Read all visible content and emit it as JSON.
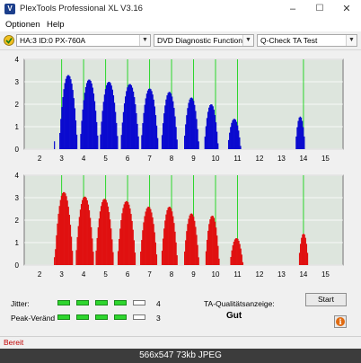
{
  "window": {
    "title": "PlexTools Professional XL V3.16",
    "app_icon_letter": "V",
    "minimize": "–",
    "maximize": "☐",
    "close": "✕"
  },
  "menu": [
    "Optionen",
    "Help"
  ],
  "toolbar": {
    "drive": "HA:3 ID:0  PX-760A",
    "function": "DVD Diagnostic Functions",
    "test": "Q-Check TA Test",
    "arrow": "▼"
  },
  "chart_data": [
    {
      "type": "bar",
      "name_key": "top",
      "color": "#0a0acf",
      "ylim": [
        0,
        4
      ],
      "yticks": [
        "0",
        "1",
        "2",
        "3",
        "4"
      ],
      "xlim": [
        1.3,
        15.8
      ],
      "xticks": [
        "2",
        "3",
        "4",
        "5",
        "6",
        "7",
        "8",
        "9",
        "10",
        "11",
        "12",
        "13",
        "14",
        "15"
      ],
      "green_lines": [
        3,
        4,
        5,
        6,
        7,
        8,
        9,
        10,
        11,
        14
      ],
      "peaks": [
        {
          "center": 3.3,
          "height": 3.3,
          "width": 0.85
        },
        {
          "center": 4.25,
          "height": 3.1,
          "width": 0.85
        },
        {
          "center": 5.15,
          "height": 3.0,
          "width": 0.85
        },
        {
          "center": 6.1,
          "height": 2.9,
          "width": 0.85
        },
        {
          "center": 7.0,
          "height": 2.7,
          "width": 0.8
        },
        {
          "center": 7.9,
          "height": 2.55,
          "width": 0.75
        },
        {
          "center": 8.9,
          "height": 2.3,
          "width": 0.7
        },
        {
          "center": 9.8,
          "height": 2.0,
          "width": 0.65
        },
        {
          "center": 10.85,
          "height": 1.35,
          "width": 0.6
        },
        {
          "center": 13.85,
          "height": 1.45,
          "width": 0.45
        }
      ]
    },
    {
      "type": "bar",
      "name_key": "bottom",
      "color": "#e01010",
      "ylim": [
        0,
        4
      ],
      "yticks": [
        "0",
        "1",
        "2",
        "3",
        "4"
      ],
      "xlim": [
        1.3,
        15.8
      ],
      "xticks": [
        "2",
        "3",
        "4",
        "5",
        "6",
        "7",
        "8",
        "9",
        "10",
        "11",
        "12",
        "13",
        "14",
        "15"
      ],
      "green_lines": [
        3,
        4,
        5,
        6,
        7,
        8,
        9,
        10,
        11,
        14
      ],
      "peaks": [
        {
          "center": 3.1,
          "height": 3.25,
          "width": 0.85
        },
        {
          "center": 4.05,
          "height": 3.05,
          "width": 0.85
        },
        {
          "center": 4.95,
          "height": 2.95,
          "width": 0.85
        },
        {
          "center": 5.95,
          "height": 2.85,
          "width": 0.85
        },
        {
          "center": 6.95,
          "height": 2.6,
          "width": 0.8
        },
        {
          "center": 7.9,
          "height": 2.6,
          "width": 0.75
        },
        {
          "center": 8.9,
          "height": 2.3,
          "width": 0.7
        },
        {
          "center": 9.85,
          "height": 2.2,
          "width": 0.65
        },
        {
          "center": 10.95,
          "height": 1.2,
          "width": 0.6
        },
        {
          "center": 14.0,
          "height": 1.4,
          "width": 0.45
        }
      ]
    }
  ],
  "results": {
    "jitter_label": "Jitter:",
    "jitter_value": "4",
    "jitter_level": 4,
    "peak_label": "Peak-Veränd",
    "peak_value": "3",
    "peak_level": 4,
    "segments_total": 5,
    "quality_label": "TA-Qualitätsanzeige:",
    "quality_value": "Gut",
    "start_label": "Start",
    "info_glyph": "i"
  },
  "status": "Bereit",
  "caption": "566x547 73kb JPEG"
}
